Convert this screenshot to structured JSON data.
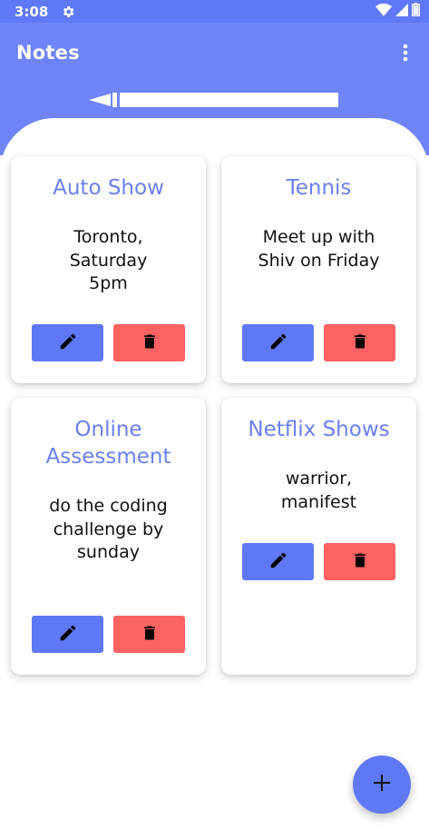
{
  "status_bar": {
    "time": "3:08"
  },
  "app_bar": {
    "title": "Notes"
  },
  "notes": [
    {
      "title": "Auto Show",
      "body": "Toronto, Saturday 5pm"
    },
    {
      "title": "Tennis",
      "body": "Meet up with Shiv on Friday"
    },
    {
      "title": "Online Assessment",
      "body": "do the coding challenge by sunday"
    },
    {
      "title": "Netflix Shows",
      "body": "warrior, manifest"
    }
  ],
  "colors": {
    "primary": "#6e84f8",
    "status": "#5f79f6",
    "delete": "#fb6262",
    "title_text": "#6a80f2"
  },
  "icons": [
    "settings-gear-icon",
    "wifi-icon",
    "signal-icon",
    "battery-icon",
    "overflow-menu-icon",
    "pencil-icon",
    "trash-icon",
    "plus-icon"
  ]
}
